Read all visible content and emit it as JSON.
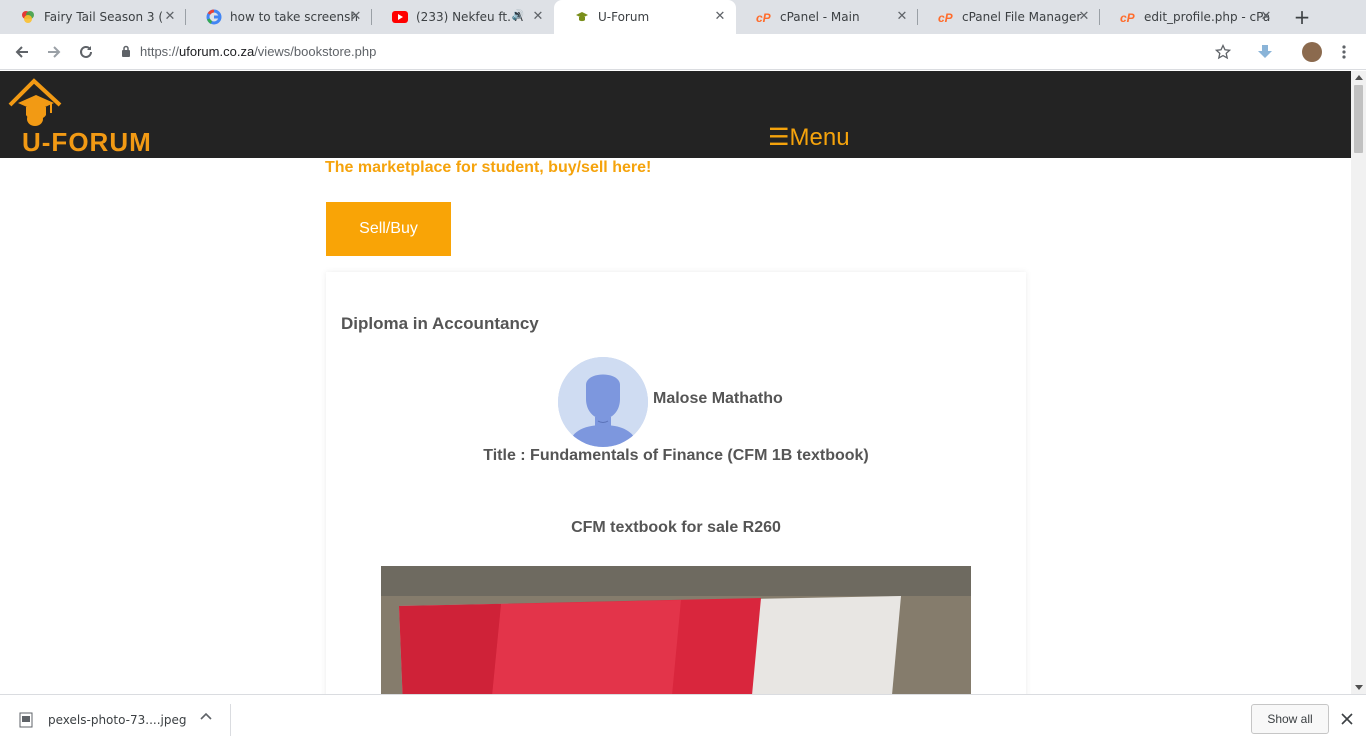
{
  "browser": {
    "tabs": [
      {
        "title": "Fairy Tail Season 3 (",
        "icon": "colorful-favicon",
        "active": false
      },
      {
        "title": "how to take screensh",
        "icon": "google-icon",
        "active": false
      },
      {
        "title": "(233) Nekfeu ft. A",
        "icon": "youtube-icon",
        "active": false
      },
      {
        "title": "U-Forum",
        "icon": "uforum-icon",
        "active": true
      },
      {
        "title": "cPanel - Main",
        "icon": "cpanel-icon",
        "active": false
      },
      {
        "title": "cPanel File Manager",
        "icon": "cpanel-icon",
        "active": false
      },
      {
        "title": "edit_profile.php - cPa",
        "icon": "cpanel-icon",
        "active": false
      }
    ],
    "url_prefix": "https://",
    "url_host": "uforum.co.za",
    "url_path": "/views/bookstore.php"
  },
  "site": {
    "logo_text": "U-FORUM",
    "menu_label": "☰Menu",
    "tagline": "The marketplace for student, buy/sell here!",
    "sell_button": "Sell/Buy"
  },
  "listing": {
    "course": "Diploma in Accountancy",
    "seller": "Malose Mathatho",
    "title": "Title : Fundamentals of Finance (CFM 1B textbook)",
    "description": "CFM textbook for sale R260"
  },
  "downloads": {
    "file_name": "pexels-photo-73....jpeg",
    "show_all": "Show all"
  },
  "colors": {
    "accent": "#f5a30c",
    "header_bg": "#232323",
    "button_bg": "#f9a406"
  }
}
